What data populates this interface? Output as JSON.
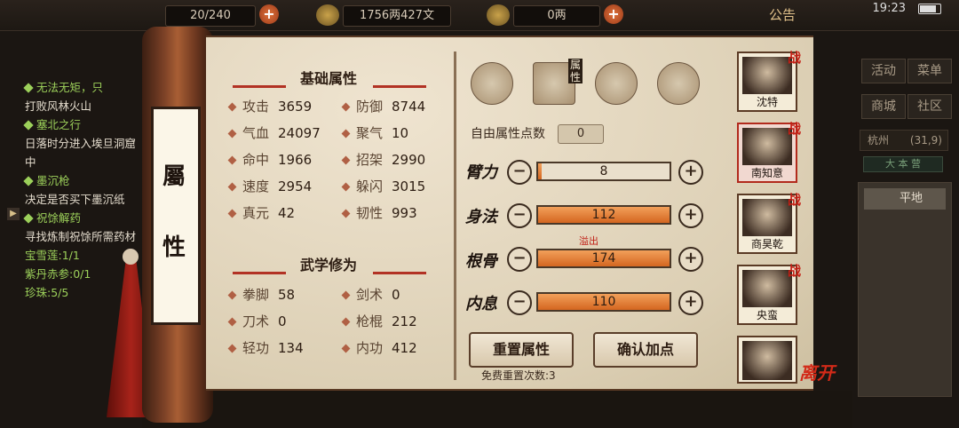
{
  "topbar": {
    "stamina": "20/240",
    "money": "1756两427文",
    "gold": "0两",
    "notice": "公告",
    "time": "19:23"
  },
  "quests": [
    {
      "title": "无法无矩，只",
      "desc": "打败风林火山"
    },
    {
      "title": "塞北之行",
      "desc": "日落时分进入埃旦洞窟中"
    },
    {
      "title": "墨沉枪",
      "desc": "决定是否买下墨沉纸"
    },
    {
      "title": "祝馀解药",
      "desc": "寻找炼制祝馀所需药材"
    }
  ],
  "quest_items": [
    "宝雪莲:1/1",
    "紫丹赤参:0/1",
    "珍珠:5/5"
  ],
  "right_menu": {
    "activity": "活动",
    "menu": "菜单",
    "shop": "商城",
    "community": "社区",
    "city": "杭州",
    "coords": "(31,9)",
    "mode": "大 本 营",
    "terrain": "平地"
  },
  "scroll": {
    "title_char1": "屬",
    "title_char2": "性"
  },
  "basic": {
    "title": "基础属性",
    "stats": [
      {
        "name": "攻击",
        "value": "3659"
      },
      {
        "name": "防御",
        "value": "8744"
      },
      {
        "name": "气血",
        "value": "24097"
      },
      {
        "name": "聚气",
        "value": "10"
      },
      {
        "name": "命中",
        "value": "1966"
      },
      {
        "name": "招架",
        "value": "2990"
      },
      {
        "name": "速度",
        "value": "2954"
      },
      {
        "name": "躲闪",
        "value": "3015"
      },
      {
        "name": "真元",
        "value": "42"
      },
      {
        "name": "韧性",
        "value": "993"
      }
    ]
  },
  "martial": {
    "title": "武学修为",
    "stats": [
      {
        "name": "拳脚",
        "value": "58"
      },
      {
        "name": "剑术",
        "value": "0"
      },
      {
        "name": "刀术",
        "value": "0"
      },
      {
        "name": "枪棍",
        "value": "212"
      },
      {
        "name": "轻功",
        "value": "134"
      },
      {
        "name": "内功",
        "value": "412"
      }
    ]
  },
  "tabs": {
    "attr_label": "属性"
  },
  "attrs": {
    "free_label": "自由属性点数",
    "free_value": "0",
    "overflow_label": "溢出",
    "items": [
      {
        "name": "臂力",
        "value": "8",
        "fill": 0.01
      },
      {
        "name": "身法",
        "value": "112",
        "fill": 1.0
      },
      {
        "name": "根骨",
        "value": "174",
        "fill": 1.0
      },
      {
        "name": "内息",
        "value": "110",
        "fill": 1.0
      }
    ]
  },
  "buttons": {
    "reset": "重置属性",
    "confirm": "确认加点",
    "free_reset": "免费重置次数:3"
  },
  "party": [
    {
      "name": "沈特",
      "tag": "战"
    },
    {
      "name": "南知意",
      "tag": "战",
      "selected": true
    },
    {
      "name": "商昊乾",
      "tag": "战"
    },
    {
      "name": "央蛮",
      "tag": "战"
    },
    {
      "name": "",
      "tag": ""
    }
  ],
  "leave": "离开",
  "colors": {
    "accent_red": "#c41e14",
    "bar_fill": "#d46620",
    "quest_green": "#9cd05a"
  }
}
